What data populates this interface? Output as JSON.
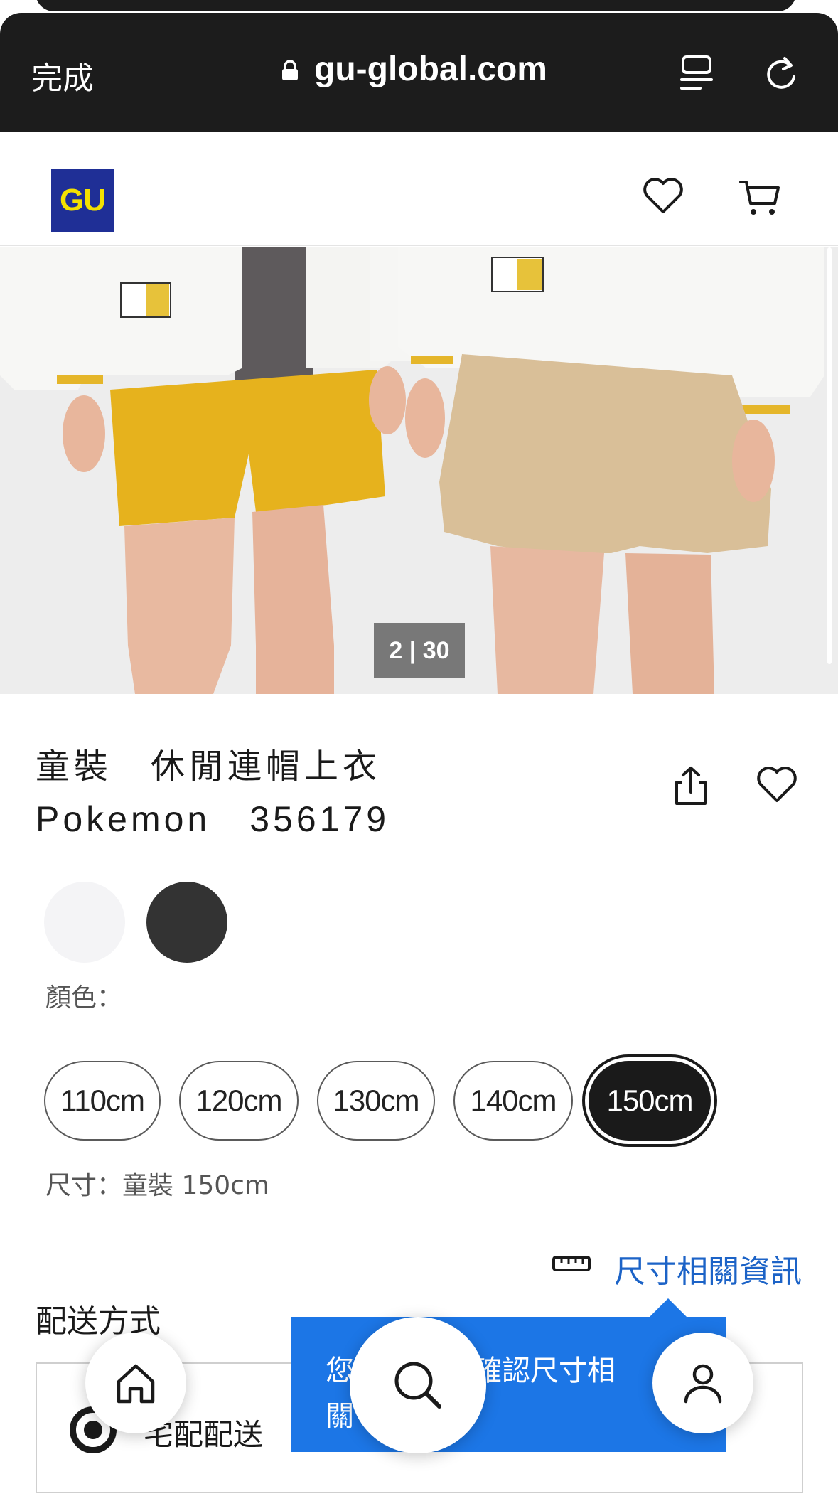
{
  "browser": {
    "done_label": "完成",
    "url": "gu-global.com"
  },
  "header": {
    "logo_text": "GU"
  },
  "gallery": {
    "position": "2 | 30"
  },
  "product": {
    "title_line1": "童裝　休閒連帽上衣",
    "title_line2": "Pokemon　356179"
  },
  "colors": {
    "label": "顏色：",
    "swatches": [
      "#f4f4f6",
      "#333333"
    ]
  },
  "sizes": {
    "options": [
      "110cm",
      "120cm",
      "130cm",
      "140cm",
      "150cm"
    ],
    "selected": "150cm",
    "label": "尺寸：童裝 150cm"
  },
  "size_info": {
    "link_label": "尺寸相關資訊"
  },
  "delivery": {
    "title": "配送方式",
    "option_visible": "宅配配送"
  },
  "tooltip": {
    "left_text_line1": "您",
    "left_text_line2": "關",
    "right_text": "確認尺寸相"
  },
  "colors_theme": {
    "accent_blue": "#1c63c7",
    "tooltip_blue": "#1c76e6",
    "logo_bg": "#1f2f96",
    "logo_fg": "#f4e100"
  }
}
